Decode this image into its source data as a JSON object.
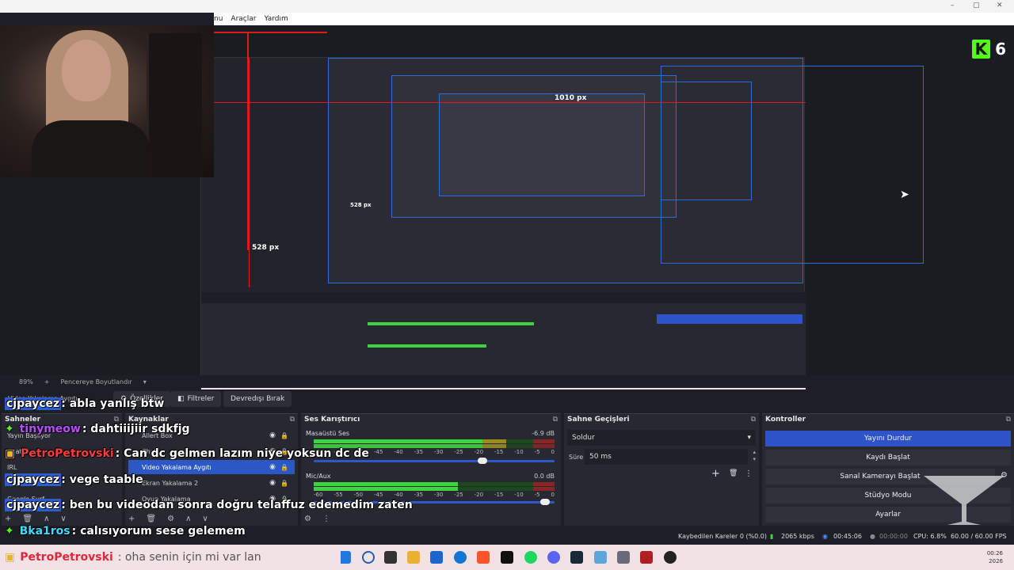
{
  "menu": {
    "items": [
      "nu",
      "Araçlar",
      "Yardım"
    ]
  },
  "window_buttons": [
    "–",
    "▢",
    "✕"
  ],
  "kick": {
    "logo": "K",
    "count": "6"
  },
  "preview": {
    "labels": {
      "top": "1010 px",
      "left": "528 px",
      "inner": "528 px"
    }
  },
  "zoombar": {
    "zoom": "89%",
    "add": "+",
    "fit": "Pencereye Boyutlandır"
  },
  "toolbar": {
    "source_name": "Video Yakalama Aygıtı",
    "properties": "Özellikler",
    "filters": "Filtreler",
    "deactivate": "Devredışı Bırak"
  },
  "scenes": {
    "title": "Sahneler",
    "items": [
      "Yayın Başlıyor",
      "Chat",
      "IRL",
      "",
      "Google Surf"
    ]
  },
  "sources": {
    "title": "Kaynaklar",
    "items": [
      "Allert Box",
      "Chat",
      "Video Yakalama Aygıtı",
      "Ekran Yakalama 2",
      "Oyun Yakalama"
    ]
  },
  "mixer": {
    "title": "Ses Karıştırıcı",
    "channels": [
      {
        "name": "Masaüstü Ses",
        "db": "-6.9 dB",
        "level": 0.8,
        "volume": 0.72
      },
      {
        "name": "Mic/Aux",
        "db": "0.0 dB",
        "level": 0.6,
        "volume": 0.98
      }
    ],
    "ticks": [
      "-60",
      "-55",
      "-50",
      "-45",
      "-40",
      "-35",
      "-30",
      "-25",
      "-20",
      "-15",
      "-10",
      "-5",
      "0"
    ]
  },
  "transitions": {
    "title": "Sahne Geçişleri",
    "type": "Soldur",
    "duration_label": "Süre",
    "duration_value": "50 ms"
  },
  "controls": {
    "title": "Kontroller",
    "buttons": [
      "Yayını Durdur",
      "Kaydı Başlat",
      "Sanal Kamerayı Başlat",
      "Stüdyo Modu",
      "Ayarlar"
    ]
  },
  "status": {
    "dropped": "Kaybedilen Kareler 0 (%0.0)",
    "bitrate": "2065 kbps",
    "live_time": "00:45:06",
    "rec_time": "00:00:00",
    "cpu": "CPU: 6.8%",
    "fps": "60.00 / 60.00 FPS"
  },
  "chat": [
    {
      "user": "cjpaycez",
      "text": ": abla yanlış btw",
      "style": "blue",
      "badge": ""
    },
    {
      "user": "tinymeow",
      "text": ": dahtiiijiir sdkfjg",
      "style": "purple",
      "badge": "✦"
    },
    {
      "user": "PetroPetrovski",
      "text": ": Can dc gelmen lazım niye yoksun dc de",
      "style": "red",
      "badge": "▣"
    },
    {
      "user": "cjpaycez",
      "text": ": vege taable",
      "style": "blue",
      "badge": ""
    },
    {
      "user": "cjpaycez",
      "text": ": ben bu videodan sonra doğru telaffuz edemedim zaten",
      "style": "blue",
      "badge": ""
    },
    {
      "user": "Bka1ros",
      "text": ": calısıyorum sese gelemem",
      "style": "cyan",
      "badge": "✦"
    },
    {
      "user": "PetroPetrovski",
      "text": ": oha senin için mi var lan",
      "style": "red",
      "badge": "▣"
    }
  ],
  "clock": {
    "time": "00:26",
    "date": "2026"
  },
  "colors": {
    "accent": "#2f54c9",
    "kick_green": "#53fc18",
    "chat_red": "#ff3b3b",
    "chat_purple": "#b94dff"
  }
}
